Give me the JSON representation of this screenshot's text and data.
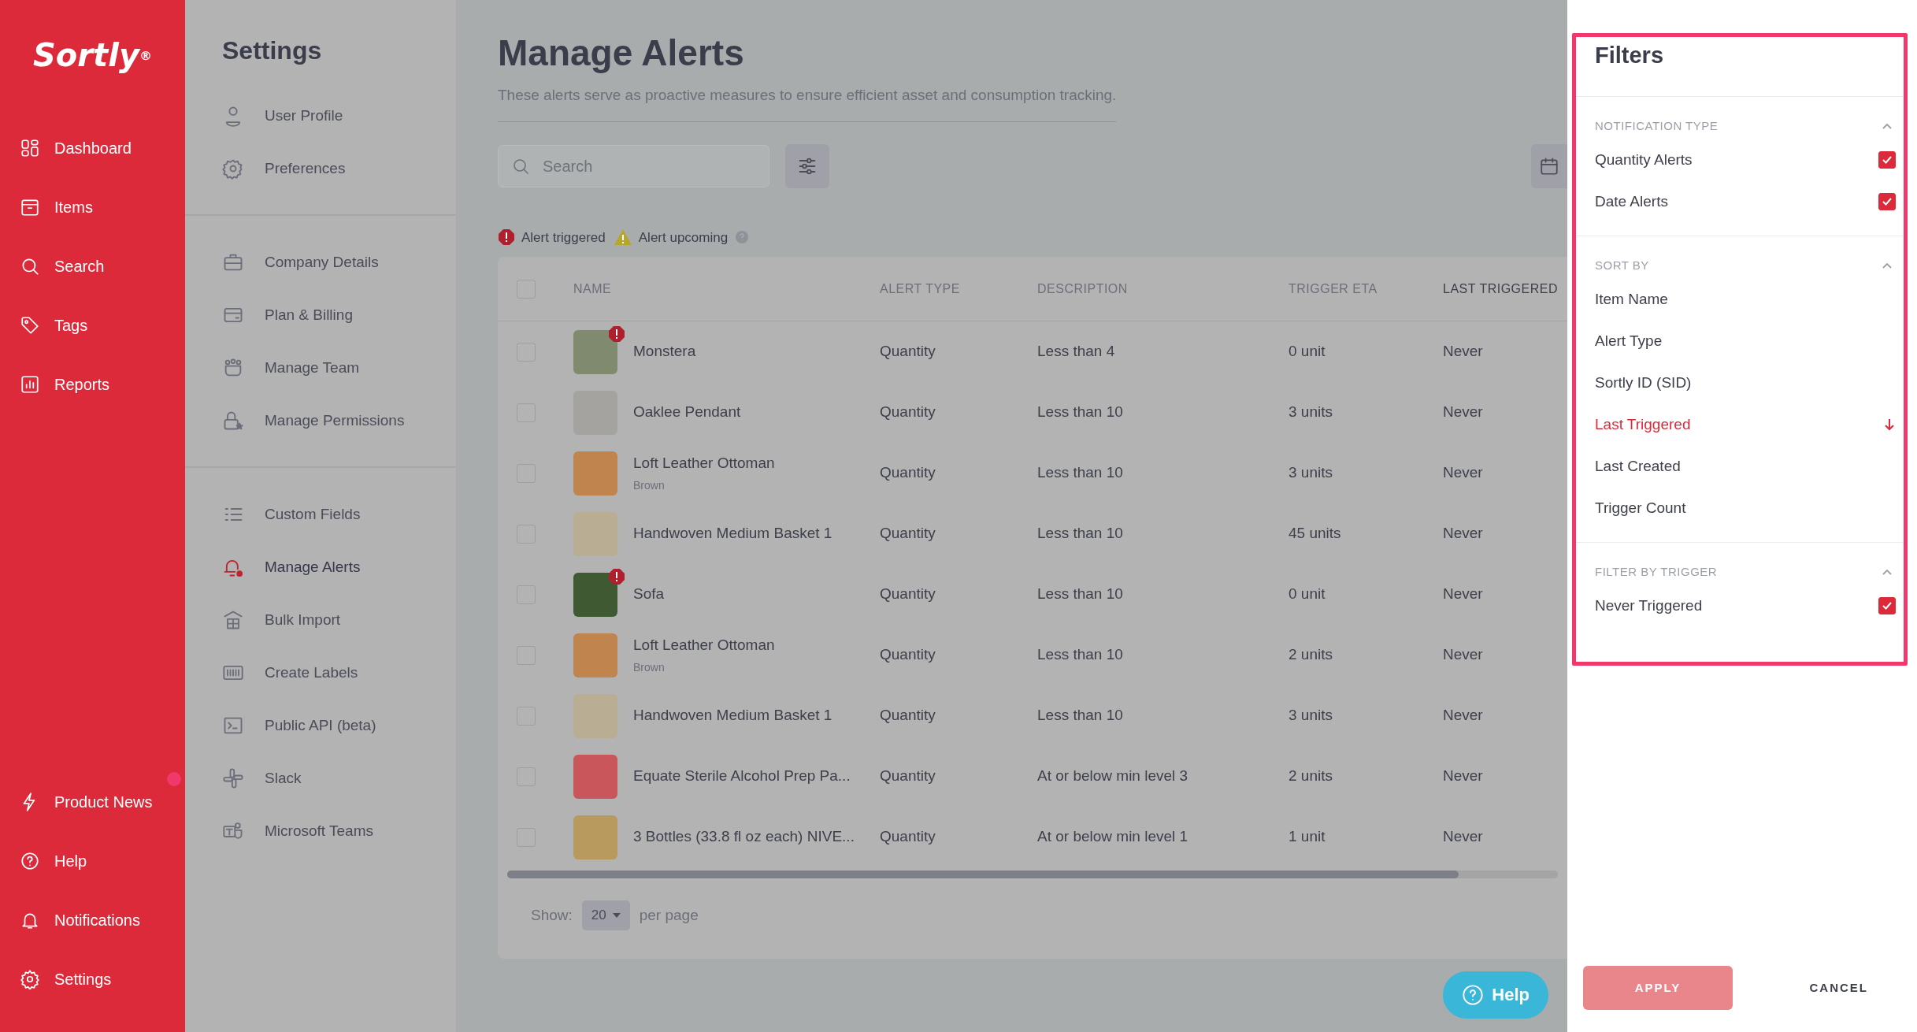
{
  "sidebar": {
    "logo": "Sortly$^{®}$",
    "top_items": [
      {
        "label": "Dashboard"
      },
      {
        "label": "Items"
      },
      {
        "label": "Search"
      },
      {
        "label": "Tags"
      },
      {
        "label": "Reports"
      }
    ],
    "bottom_items": [
      {
        "label": "Product News",
        "new": true
      },
      {
        "label": "Help",
        "new": false
      },
      {
        "label": "Notifications",
        "new": false
      },
      {
        "label": "Settings",
        "new": false
      }
    ]
  },
  "settings_menu": {
    "title": "Settings",
    "groups": [
      [
        {
          "label": "User Profile",
          "selected": false
        },
        {
          "label": "Preferences",
          "selected": false
        }
      ],
      [
        {
          "label": "Company Details",
          "selected": false
        },
        {
          "label": "Plan & Billing",
          "selected": false
        },
        {
          "label": "Manage Team",
          "selected": false
        },
        {
          "label": "Manage Permissions",
          "selected": false
        }
      ],
      [
        {
          "label": "Custom Fields",
          "selected": false
        },
        {
          "label": "Manage Alerts",
          "selected": true
        },
        {
          "label": "Bulk Import",
          "selected": false
        },
        {
          "label": "Create Labels",
          "selected": false
        },
        {
          "label": "Public API (beta)",
          "selected": false
        },
        {
          "label": "Slack",
          "selected": false
        },
        {
          "label": "Microsoft Teams",
          "selected": false
        }
      ]
    ]
  },
  "main": {
    "title": "Manage Alerts",
    "description": "These alerts serve as proactive measures to ensure efficient asset and consumption tracking.",
    "search": {
      "placeholder": "Search"
    },
    "legend": [
      {
        "label": "Alert triggered",
        "kind": "triggered"
      },
      {
        "label": "Alert upcoming",
        "kind": "upcoming"
      }
    ],
    "table": {
      "select_all_checked": false,
      "columns": [
        "NAME",
        "ALERT TYPE",
        "DESCRIPTION",
        "TRIGGER ETA",
        "LAST TRIGGERED"
      ],
      "rows": [
        {
          "name": "Monstera",
          "triggered": true,
          "checked": false,
          "alert_type": "Quantity",
          "description": "Less than 4",
          "trigger_eta": "0 unit",
          "last_triggered": "Never"
        },
        {
          "name": "Oaklee Pendant",
          "triggered": false,
          "checked": false,
          "alert_type": "Quantity",
          "description": "Less than 10",
          "trigger_eta": "3 units",
          "last_triggered": "Never"
        },
        {
          "name": "Loft Leather Ottoman",
          "variant": "Brown",
          "triggered": false,
          "checked": false,
          "alert_type": "Quantity",
          "description": "Less than 10",
          "trigger_eta": "3 units",
          "last_triggered": "Never"
        },
        {
          "name": "Handwoven Medium Basket 1",
          "triggered": false,
          "checked": false,
          "alert_type": "Quantity",
          "description": "Less than 10",
          "trigger_eta": "45 units",
          "last_triggered": "Never"
        },
        {
          "name": "Sofa",
          "triggered": true,
          "checked": false,
          "alert_type": "Quantity",
          "description": "Less than 10",
          "trigger_eta": "0 unit",
          "last_triggered": "Never"
        },
        {
          "name": "Loft Leather Ottoman",
          "variant": "Brown",
          "triggered": false,
          "checked": false,
          "alert_type": "Quantity",
          "description": "Less than 10",
          "trigger_eta": "2 units",
          "last_triggered": "Never"
        },
        {
          "name": "Handwoven Medium Basket 1",
          "triggered": false,
          "checked": false,
          "alert_type": "Quantity",
          "description": "Less than 10",
          "trigger_eta": "3 units",
          "last_triggered": "Never"
        },
        {
          "name": "Equate Sterile Alcohol Prep Pa...",
          "triggered": false,
          "checked": false,
          "alert_type": "Quantity",
          "description": "At or below min level 3",
          "trigger_eta": "2 units",
          "last_triggered": "Never"
        },
        {
          "name": "3 Bottles (33.8 fl oz each) NIVE...",
          "triggered": false,
          "checked": false,
          "alert_type": "Quantity",
          "description": "At or below min level 1",
          "trigger_eta": "1 unit",
          "last_triggered": "Never"
        }
      ]
    },
    "pagination": {
      "label": "Show:",
      "page_size": "20",
      "suffix": "per page"
    },
    "help_button": "Help"
  },
  "filters": {
    "title": "Filters",
    "sections": [
      {
        "heading": "NOTIFICATION TYPE",
        "expanded": true,
        "options": [
          {
            "label": "Quantity Alerts",
            "kind": "checkbox",
            "checked": true
          },
          {
            "label": "Date Alerts",
            "kind": "checkbox",
            "checked": true
          }
        ]
      },
      {
        "heading": "SORT BY",
        "expanded": true,
        "options": [
          {
            "label": "Item Name",
            "kind": "sort",
            "selected": false
          },
          {
            "label": "Alert Type",
            "kind": "sort",
            "selected": false
          },
          {
            "label": "Sortly ID (SID)",
            "kind": "sort",
            "selected": false
          },
          {
            "label": "Last Triggered",
            "kind": "sort",
            "selected": true
          },
          {
            "label": "Last Created",
            "kind": "sort",
            "selected": false
          },
          {
            "label": "Trigger Count",
            "kind": "sort",
            "selected": false
          }
        ]
      },
      {
        "heading": "FILTER BY TRIGGER",
        "expanded": true,
        "options": [
          {
            "label": "Never Triggered",
            "kind": "checkbox",
            "checked": true
          }
        ]
      }
    ],
    "apply": {
      "label": "APPLY",
      "disabled": true
    },
    "cancel": "CANCEL"
  }
}
